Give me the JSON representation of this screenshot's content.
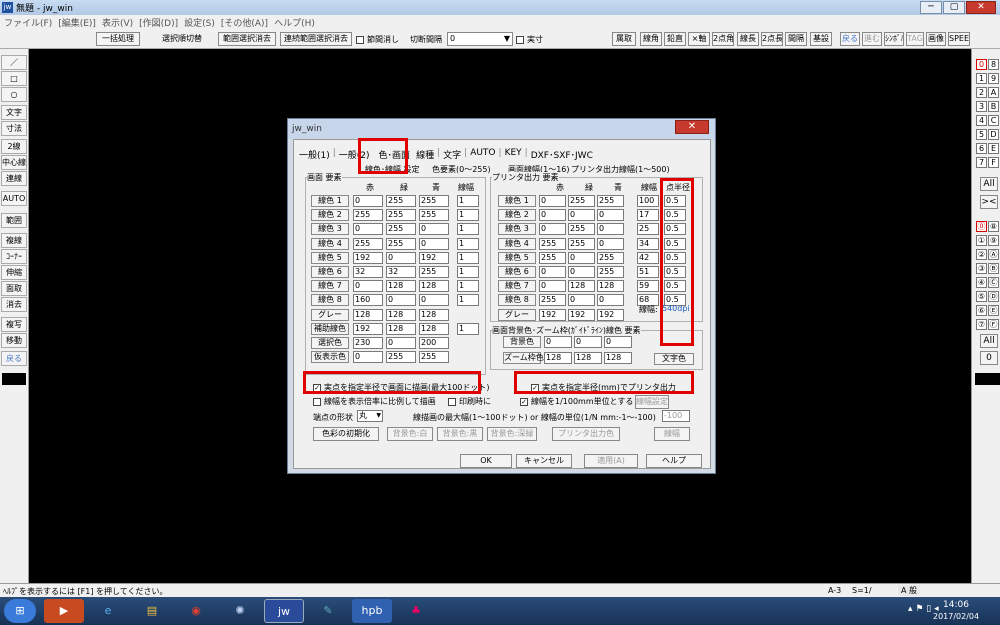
{
  "window": {
    "title": "無題 - jw_win",
    "min": "─",
    "max": "▢",
    "close": "✕"
  },
  "menubar": [
    "ファイル(F)",
    "[編集(E)]",
    "表示(V)",
    "[作図(D)]",
    "設定(S)",
    "[その他(A)]",
    "ヘルプ(H)"
  ],
  "toolbar": {
    "ikkatsu": "一括処理",
    "sentaku_kirikae": "選択順切替",
    "hanni_shokyo": "範囲選択消去",
    "renzoku_shokyo": "連続範囲選択消去",
    "setsudan_keshi": "節間消し",
    "kiridan_label": "切断間隔",
    "kiridan_value": "0",
    "jissun": "実寸",
    "right": [
      "属取",
      "線角",
      "鉛直",
      "×軸",
      "2点角",
      "線長",
      "2点長",
      "間隔",
      "基設"
    ],
    "right2": [
      "戻る",
      "進む",
      "ｼﾝﾎﾞﾙ",
      "TAG",
      "画像",
      "SPEED"
    ]
  },
  "leftbar": [
    "／",
    "□",
    "○",
    "文字",
    "寸法",
    "2線",
    "中心線",
    "連線",
    "AUTO",
    "範囲",
    "複線",
    "ｺｰﾅｰ",
    "伸縮",
    "面取",
    "消去",
    "複写",
    "移動",
    "戻る"
  ],
  "rightbar": {
    "top": [
      [
        "0",
        "8"
      ],
      [
        "1",
        "9"
      ],
      [
        "2",
        "A"
      ],
      [
        "3",
        "B"
      ],
      [
        "4",
        "C"
      ],
      [
        "5",
        "D"
      ],
      [
        "6",
        "E"
      ],
      [
        "7",
        "F"
      ]
    ],
    "all1": "All",
    "x1": "><",
    "mid": [
      [
        "⓪",
        "⑧"
      ],
      [
        "①",
        "⑨"
      ],
      [
        "②",
        "Ⓐ"
      ],
      [
        "③",
        "Ⓑ"
      ],
      [
        "④",
        "Ⓒ"
      ],
      [
        "⑤",
        "Ⓓ"
      ],
      [
        "⑥",
        "Ⓔ"
      ],
      [
        "⑦",
        "Ⓕ"
      ]
    ],
    "all2": "All",
    "zero": "0"
  },
  "status": {
    "help": "ﾍﾙﾌﾟを表示するには [F1] を押してください。",
    "scale": "A-3",
    "s": "S=1/",
    "ime": "A 般"
  },
  "taskbar": {
    "time": "14:06",
    "date": "2017/02/04"
  },
  "dialog": {
    "title": "jw_win",
    "close": "✕",
    "tabs": [
      "一般(1)",
      "一般(2)",
      "色･画面",
      "線種",
      "文字",
      "AUTO",
      "KEY",
      "DXF･SXF･JWC"
    ],
    "sub1": "線色･線幅 設定",
    "sub2": "色要素(0〜255)",
    "sub3": "画面線幅(1〜16)",
    "sub4": "プリンタ出力線幅(1〜500)",
    "screen_group": "画面 要素",
    "printer_group": "プリンタ出力 要素",
    "hdr": {
      "r": "赤",
      "g": "緑",
      "b": "青",
      "w": "線幅",
      "pt": "点半径"
    },
    "screen_rows": [
      {
        "label": "線色 1",
        "r": "0",
        "g": "255",
        "b": "255",
        "w": "1"
      },
      {
        "label": "線色 2",
        "r": "255",
        "g": "255",
        "b": "255",
        "w": "1"
      },
      {
        "label": "線色 3",
        "r": "0",
        "g": "255",
        "b": "0",
        "w": "1"
      },
      {
        "label": "線色 4",
        "r": "255",
        "g": "255",
        "b": "0",
        "w": "1"
      },
      {
        "label": "線色 5",
        "r": "192",
        "g": "0",
        "b": "192",
        "w": "1"
      },
      {
        "label": "線色 6",
        "r": "32",
        "g": "32",
        "b": "255",
        "w": "1"
      },
      {
        "label": "線色 7",
        "r": "0",
        "g": "128",
        "b": "128",
        "w": "1"
      },
      {
        "label": "線色 8",
        "r": "160",
        "g": "0",
        "b": "0",
        "w": "1"
      },
      {
        "label": "グレー",
        "r": "128",
        "g": "128",
        "b": "128",
        "w": ""
      },
      {
        "label": "補助線色",
        "r": "192",
        "g": "128",
        "b": "128",
        "w": "1"
      },
      {
        "label": "選択色",
        "r": "230",
        "g": "0",
        "b": "200",
        "w": ""
      },
      {
        "label": "仮表示色",
        "r": "0",
        "g": "255",
        "b": "255",
        "w": ""
      }
    ],
    "printer_rows": [
      {
        "label": "線色 1",
        "r": "0",
        "g": "255",
        "b": "255",
        "w": "100",
        "pt": "0.5"
      },
      {
        "label": "線色 2",
        "r": "0",
        "g": "0",
        "b": "0",
        "w": "17",
        "pt": "0.5"
      },
      {
        "label": "線色 3",
        "r": "0",
        "g": "255",
        "b": "0",
        "w": "25",
        "pt": "0.5"
      },
      {
        "label": "線色 4",
        "r": "255",
        "g": "255",
        "b": "0",
        "w": "34",
        "pt": "0.5"
      },
      {
        "label": "線色 5",
        "r": "255",
        "g": "0",
        "b": "255",
        "w": "42",
        "pt": "0.5"
      },
      {
        "label": "線色 6",
        "r": "0",
        "g": "0",
        "b": "255",
        "w": "51",
        "pt": "0.5"
      },
      {
        "label": "線色 7",
        "r": "0",
        "g": "128",
        "b": "128",
        "w": "59",
        "pt": "0.5"
      },
      {
        "label": "線色 8",
        "r": "255",
        "g": "0",
        "b": "0",
        "w": "68",
        "pt": "0.5"
      },
      {
        "label": "グレー",
        "r": "192",
        "g": "192",
        "b": "192",
        "w": "",
        "pt": ""
      }
    ],
    "gray_width_label": "線幅:",
    "gray_width_value": "540dpi",
    "bg_group": "画面背景色･ズーム枠(ｶﾞｲﾄﾞﾗｲﾝ)線色 要素",
    "bg_row": {
      "label": "背景色",
      "r": "0",
      "g": "0",
      "b": "0"
    },
    "zoom_row": {
      "label": "ズーム枠色",
      "r": "128",
      "g": "128",
      "b": "128"
    },
    "moji_color": "文字色",
    "cb1": "実点を指定半径で画面に描画(最大100ドット)",
    "cb2": "実点を指定半径(mm)でプリンタ出力",
    "cb3": "線幅を表示倍率に比例して描画",
    "cb3b": "印刷時に",
    "cb4": "線幅を1/100mm単位とする",
    "cb4btn": "線幅設定",
    "tanten_label": "端点の形状",
    "tanten_value": "丸",
    "maxw_label": "線描画の最大幅(1〜100ドット) or 線幅の単位(1/N mm:-1〜-100)",
    "maxw_value": "-100",
    "btn_init": "色彩の初期化",
    "btn_white": "背景色:白",
    "btn_black": "背景色:黒",
    "btn_deep": "背景色:深緑",
    "btn_print": "プリンタ出力色",
    "btn_width": "線幅",
    "ok": "OK",
    "cancel": "キャンセル",
    "apply": "適用(A)",
    "help": "ヘルプ"
  }
}
